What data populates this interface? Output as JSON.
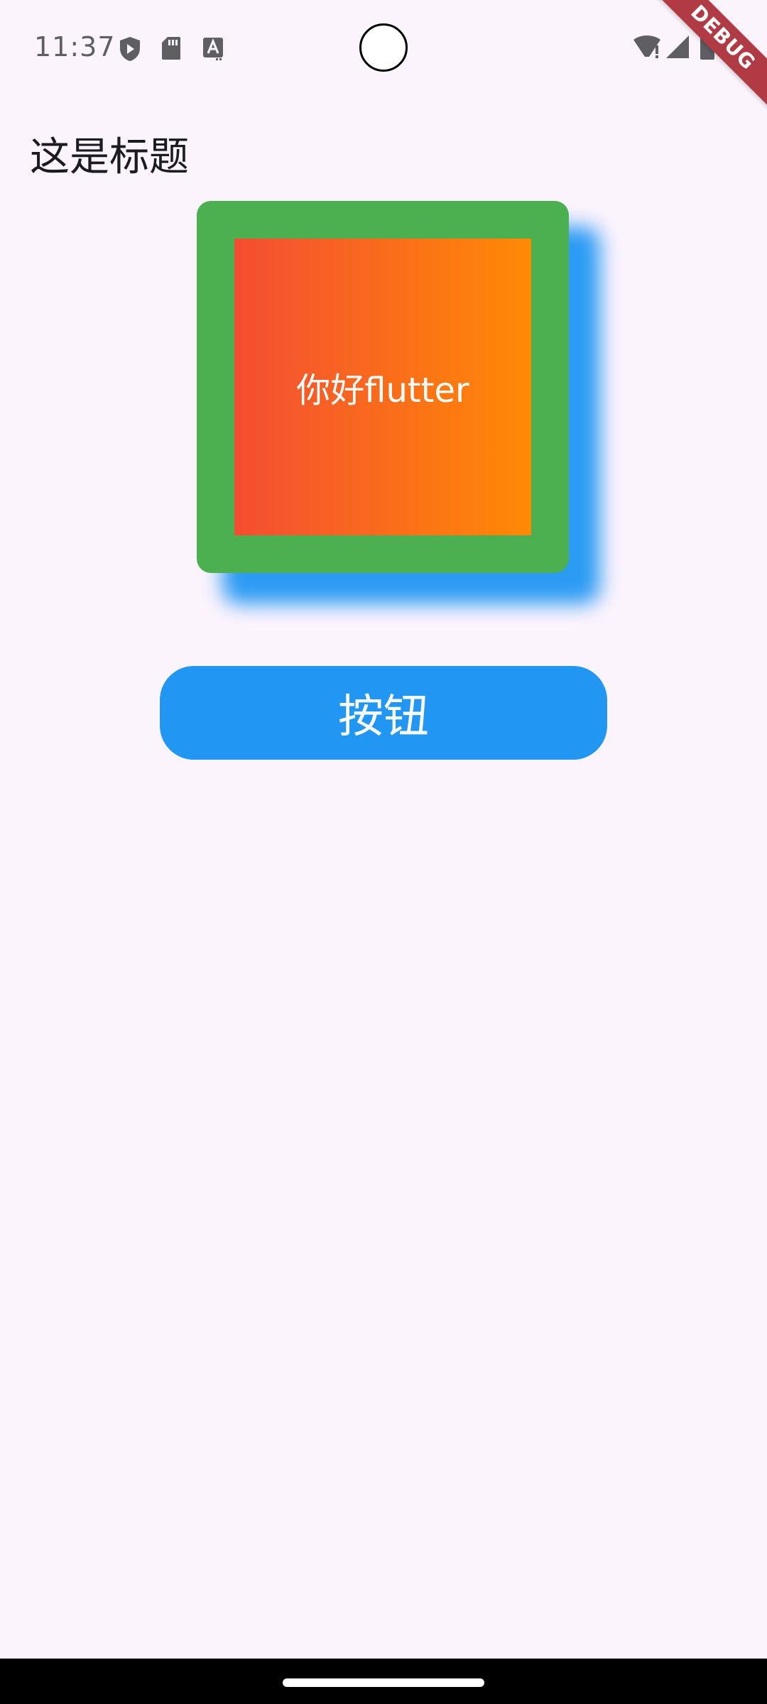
{
  "status_bar": {
    "time": "11:37",
    "left_icons": [
      "shield-play-icon",
      "sd-card-icon",
      "font-a-icon"
    ],
    "right_icons": [
      "wifi-alert-icon",
      "signal-icon",
      "battery-icon"
    ]
  },
  "debug_banner": {
    "label": "DEBUG"
  },
  "title": "这是标题",
  "card": {
    "text": "你好flutter",
    "colors": {
      "border": "#4caf50",
      "gradient_start": "#f44d32",
      "gradient_end": "#ff8a05",
      "shadow": "#2196f3"
    }
  },
  "button": {
    "label": "按钮",
    "color": "#2196f3"
  },
  "colors": {
    "background": "#fcf4fd",
    "nav_bar": "#000000"
  }
}
